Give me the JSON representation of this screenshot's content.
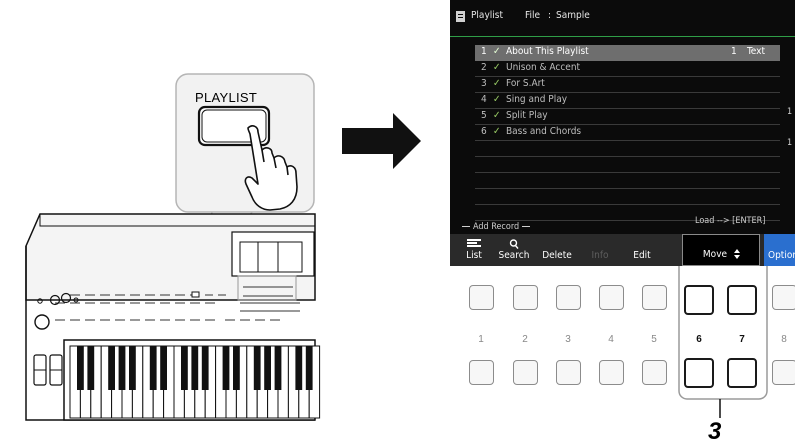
{
  "panel_button_label": "PLAYLIST",
  "screen": {
    "header": {
      "title": "Playlist",
      "file_label": "File",
      "file_sep": ":",
      "file_name": "Sample"
    },
    "records": [
      {
        "no": "1",
        "name": "About This Playlist",
        "page": "1",
        "type": "Text",
        "selected": true
      },
      {
        "no": "2",
        "name": "Unison & Accent",
        "selected": false
      },
      {
        "no": "3",
        "name": "For S.Art",
        "selected": false
      },
      {
        "no": "4",
        "name": "Sing and Play",
        "selected": false
      },
      {
        "no": "5",
        "name": "Split Play",
        "selected": false
      },
      {
        "no": "6",
        "name": "Bass and Chords",
        "selected": false
      }
    ],
    "check_mark": "✓",
    "add_record": "Add Record",
    "load_hint": "Load --> [ENTER]",
    "right_edge_marks": [
      "1",
      "1"
    ],
    "function_bar": {
      "list": "List",
      "search": "Search",
      "delete": "Delete",
      "info": "Info",
      "edit": "Edit",
      "move": "Move",
      "option": "Option"
    }
  },
  "button_numbers": [
    "1",
    "2",
    "3",
    "4",
    "5",
    "6",
    "7",
    "8"
  ],
  "step_number": "3",
  "colors": {
    "screen_bg": "#0b0b0b",
    "selected_row": "#6e6e6e",
    "check": "#9acd66",
    "option_bg": "#2a6fcf",
    "header_rule": "#2f9e47"
  }
}
